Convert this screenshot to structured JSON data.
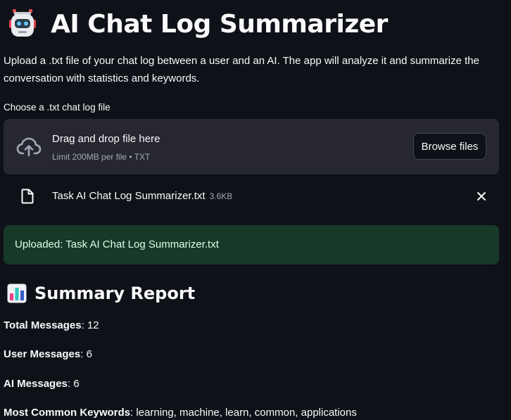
{
  "header": {
    "title": "AI Chat Log Summarizer",
    "icon": "robot-icon"
  },
  "description": "Upload a .txt file of your chat log between a user and an AI. The app will analyze it and summarize the conversation with statistics and keywords.",
  "uploader": {
    "label": "Choose a .txt chat log file",
    "drop_text": "Drag and drop file here",
    "limit_text": "Limit 200MB per file • TXT",
    "browse_label": "Browse files",
    "icon": "cloud-upload-icon"
  },
  "uploaded_file": {
    "name": "Task AI Chat Log Summarizer.txt",
    "size": "3.6KB",
    "icon": "file-icon"
  },
  "success": {
    "message": "Uploaded: Task AI Chat Log Summarizer.txt",
    "color": "#173928"
  },
  "summary": {
    "title": "Summary Report",
    "icon": "bar-chart-icon",
    "total_label": "Total Messages",
    "total_value": ": 12",
    "user_label": "User Messages",
    "user_value": ": 6",
    "ai_label": "AI Messages",
    "ai_value": ": 6",
    "keywords_label": "Most Common Keywords",
    "keywords_value": ": learning, machine, learn, common, applications"
  },
  "colors": {
    "background": "#0e1117",
    "surface": "#262730",
    "text": "#fafafa",
    "muted": "#a3a8b4",
    "accent": "#ff4b4b"
  }
}
